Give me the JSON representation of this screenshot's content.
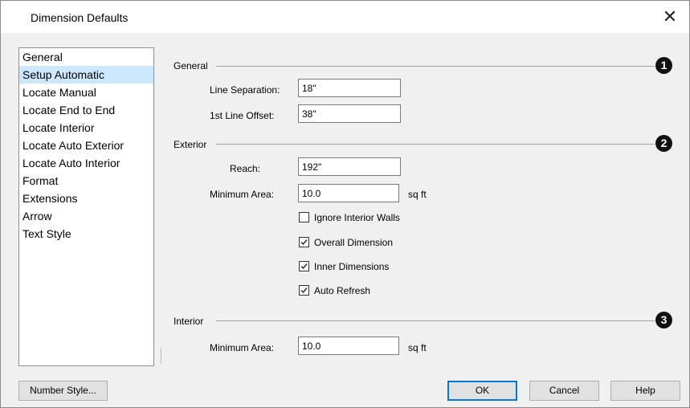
{
  "window": {
    "title": "Dimension Defaults"
  },
  "sidebar": {
    "items": [
      {
        "label": "General"
      },
      {
        "label": "Setup Automatic"
      },
      {
        "label": "Locate Manual"
      },
      {
        "label": "Locate End to End"
      },
      {
        "label": "Locate Interior"
      },
      {
        "label": "Locate Auto Exterior"
      },
      {
        "label": "Locate Auto Interior"
      },
      {
        "label": "Format"
      },
      {
        "label": "Extensions"
      },
      {
        "label": "Arrow"
      },
      {
        "label": "Text Style"
      }
    ],
    "selected": "Setup Automatic"
  },
  "general": {
    "title": "General",
    "badge": "1",
    "line_separation_label": "Line Separation:",
    "line_separation_value": "18\"",
    "first_line_offset_label": "1st Line Offset:",
    "first_line_offset_value": "38\""
  },
  "exterior": {
    "title": "Exterior",
    "badge": "2",
    "reach_label": "Reach:",
    "reach_value": "192\"",
    "min_area_label": "Minimum Area:",
    "min_area_value": "10.0",
    "min_area_unit": "sq ft",
    "checkboxes": [
      {
        "label": "Ignore Interior Walls",
        "checked": false
      },
      {
        "label": "Overall Dimension",
        "checked": true
      },
      {
        "label": "Inner Dimensions",
        "checked": true
      },
      {
        "label": "Auto Refresh",
        "checked": true
      }
    ]
  },
  "interior": {
    "title": "Interior",
    "badge": "3",
    "min_area_label": "Minimum Area:",
    "min_area_value": "10.0",
    "min_area_unit": "sq ft"
  },
  "buttons": {
    "number_style": "Number Style...",
    "ok": "OK",
    "cancel": "Cancel",
    "help": "Help"
  }
}
